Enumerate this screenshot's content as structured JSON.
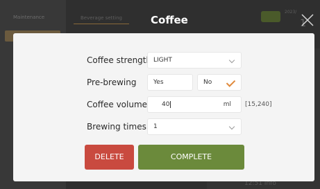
{
  "background": {
    "sidebar_item": "Maintenance",
    "tab_label": "Beverage setting",
    "date_text": "2023/",
    "big_num": "1",
    "bottom_text": "12:51 Info"
  },
  "dialog": {
    "title": "Coffee",
    "close_icon": "close-icon",
    "fields": {
      "strength": {
        "label": "Coffee strength",
        "value": "LIGHT"
      },
      "prebrewing": {
        "label": "Pre-brewing",
        "yes": "Yes",
        "no": "No",
        "selected": "No"
      },
      "volume": {
        "label": "Coffee volume",
        "value": "40",
        "unit": "ml",
        "range": "[15,240]"
      },
      "times": {
        "label": "Brewing times",
        "value": "1"
      }
    },
    "buttons": {
      "delete": "DELETE",
      "complete": "COMPLETE"
    }
  },
  "colors": {
    "delete": "#c94a3f",
    "complete": "#6b8a3b",
    "check_accent": "#e08a3c"
  }
}
